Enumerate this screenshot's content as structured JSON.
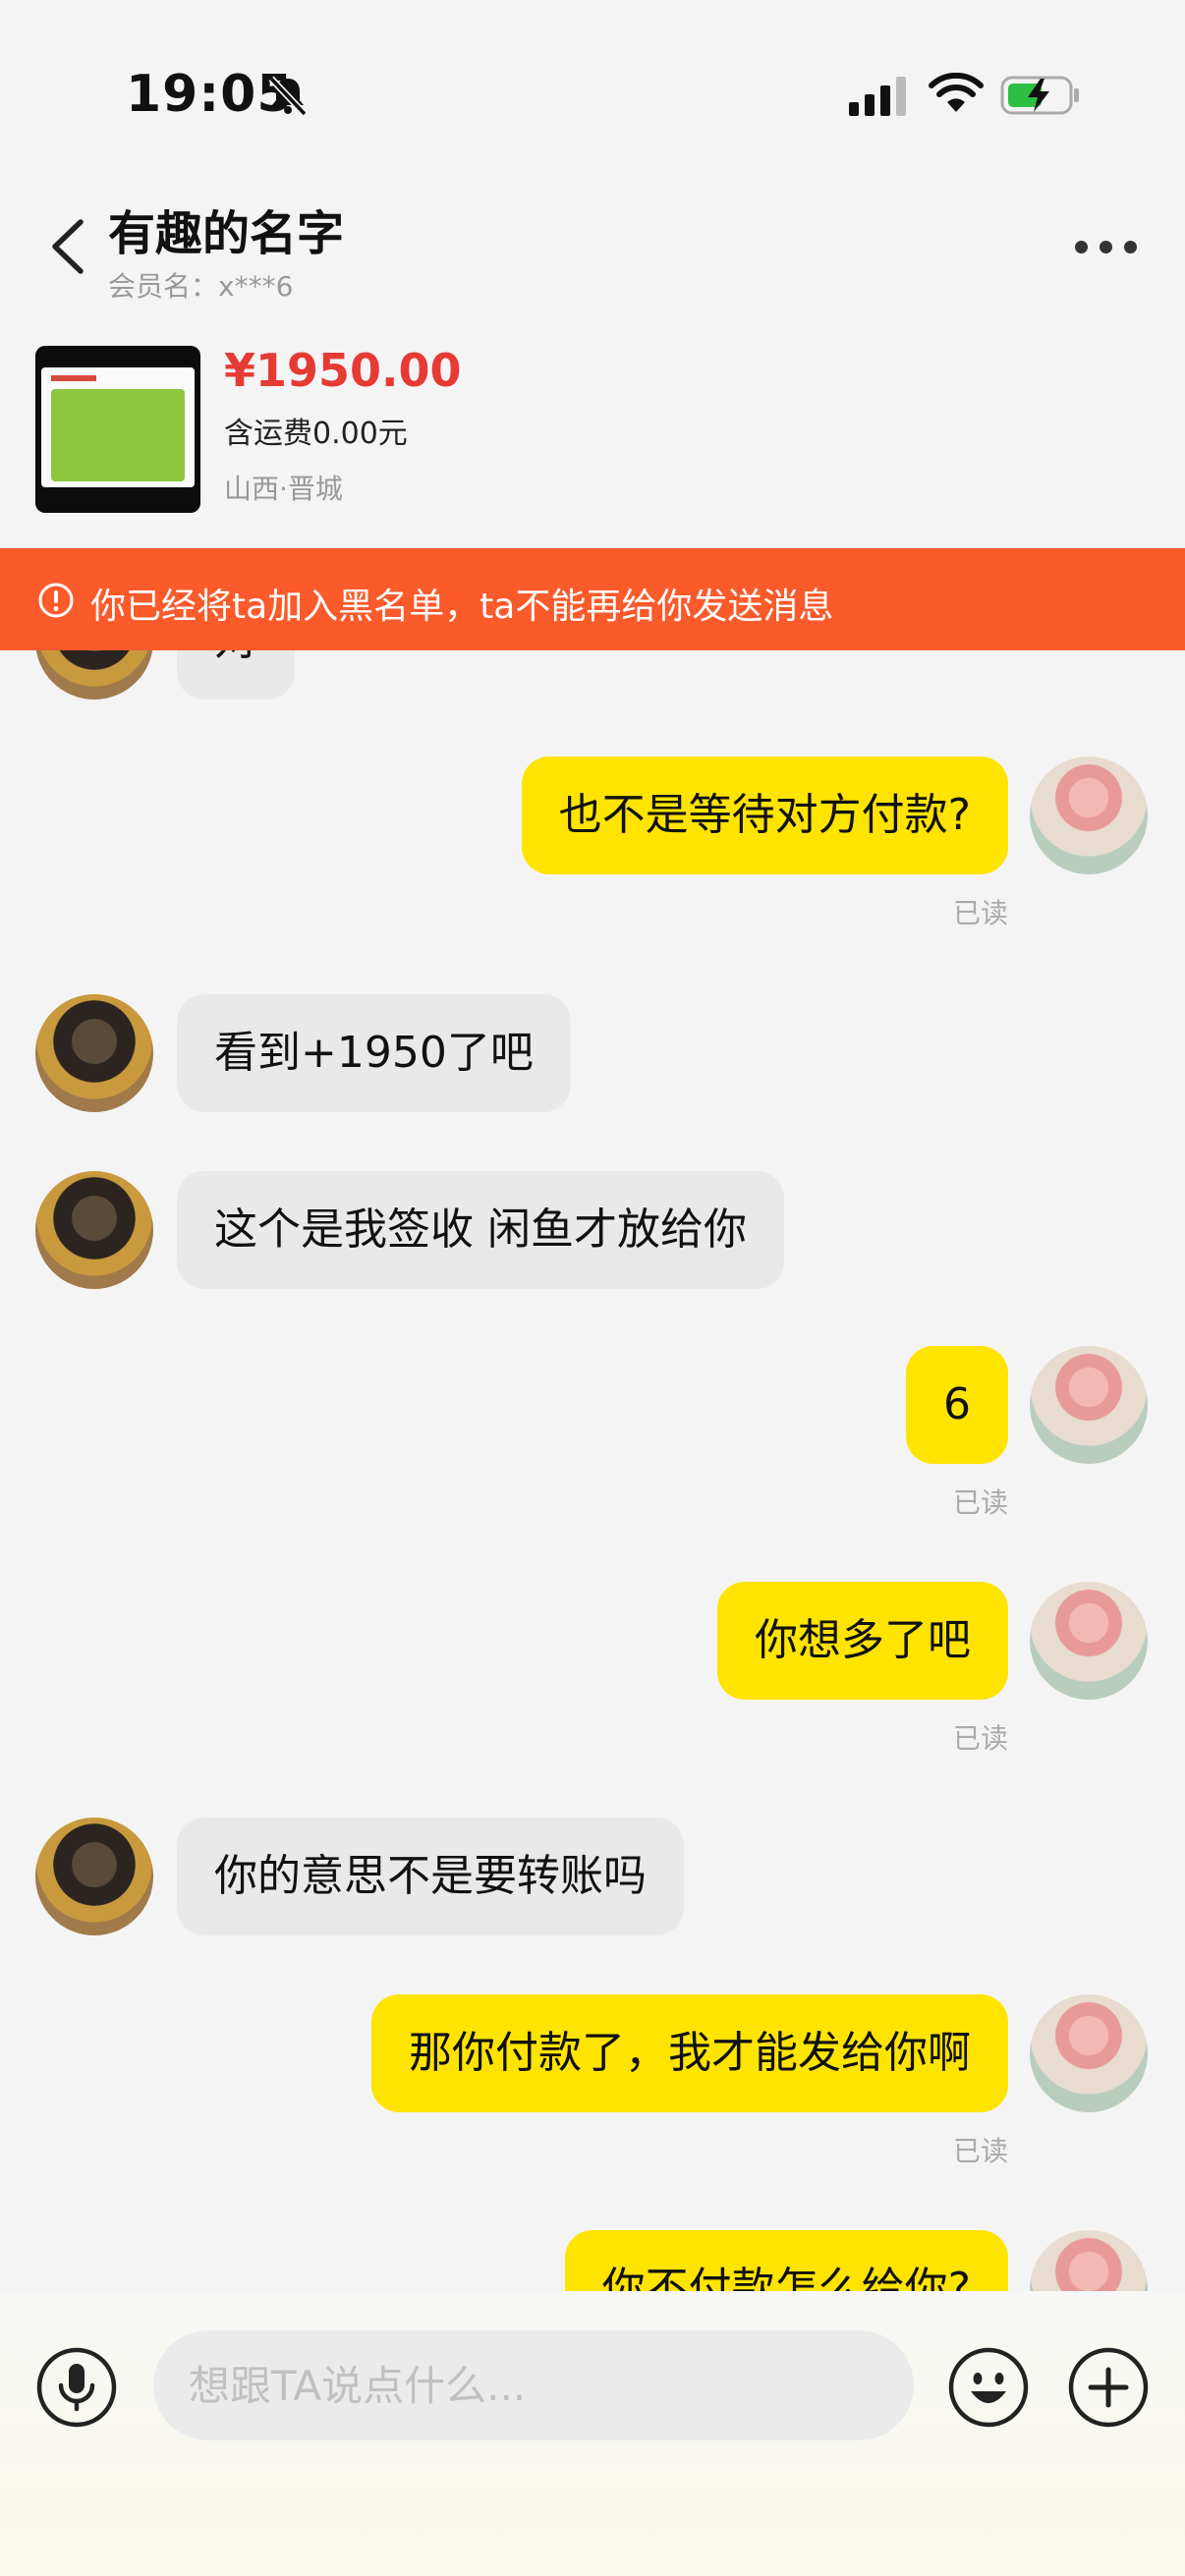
{
  "status_bar": {
    "time": "19:05",
    "icons": [
      "bell-muted-icon",
      "cell-signal-icon",
      "wifi-icon",
      "battery-charging-icon"
    ]
  },
  "header": {
    "title": "有趣的名字",
    "member_label": "会员名：x***6",
    "back_icon": "chevron-left-icon",
    "more_icon": "more-dots-icon"
  },
  "product": {
    "price": "¥1950.00",
    "shipping": "含运费0.00元",
    "location": "山西·晋城"
  },
  "banner": {
    "text": "你已经将ta加入黑名单，ta不能再给你发送消息",
    "icon": "alert-circle-icon",
    "color": "#fb5a2b"
  },
  "messages": [
    {
      "sender": "other",
      "text": "对"
    },
    {
      "sender": "self",
      "text": "也不是等待对方付款?",
      "status": "已读"
    },
    {
      "sender": "other",
      "text": "看到+1950了吧"
    },
    {
      "sender": "other",
      "text": "这个是我签收 闲鱼才放给你"
    },
    {
      "sender": "self",
      "text": "6",
      "status": "已读"
    },
    {
      "sender": "self",
      "text": "你想多了吧",
      "status": "已读"
    },
    {
      "sender": "other",
      "text": "你的意思不是要转账吗"
    },
    {
      "sender": "self",
      "text": "那你付款了，我才能发给你啊",
      "status": "已读"
    },
    {
      "sender": "self",
      "text": "你不付款怎么给你?"
    }
  ],
  "input_bar": {
    "placeholder": "想跟TA说点什么...",
    "icons": [
      "microphone-icon",
      "emoji-icon",
      "plus-icon"
    ]
  },
  "colors": {
    "self_bubble": "#ffe400",
    "other_bubble": "#e9e9e9",
    "price": "#e63a35",
    "background": "#f4f4f4"
  }
}
